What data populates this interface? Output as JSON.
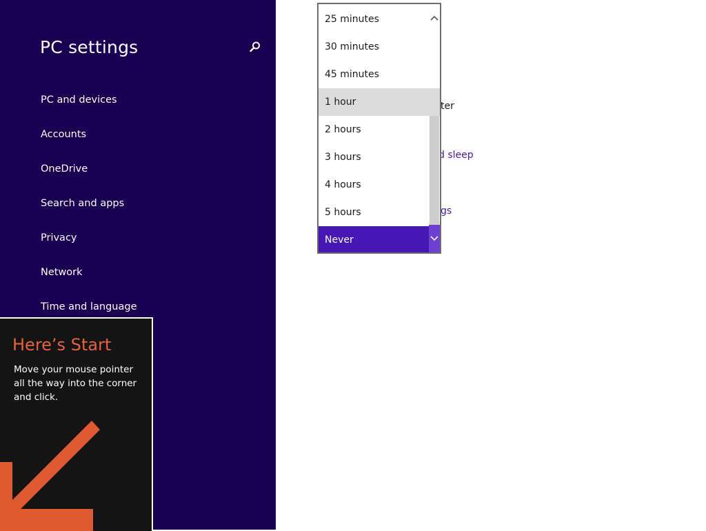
{
  "sidebar": {
    "title": "PC settings",
    "search_icon": "search-icon",
    "items": [
      {
        "label": "PC and devices"
      },
      {
        "label": "Accounts"
      },
      {
        "label": "OneDrive"
      },
      {
        "label": "Search and apps"
      },
      {
        "label": "Privacy"
      },
      {
        "label": "Network"
      },
      {
        "label": "Time and language"
      }
    ]
  },
  "content": {
    "fragment_1": "ter",
    "fragment_2": "d sleep",
    "fragment_3": "gs"
  },
  "dropdown": {
    "options": [
      {
        "label": "25 minutes"
      },
      {
        "label": "30 minutes"
      },
      {
        "label": "45 minutes"
      },
      {
        "label": "1 hour"
      },
      {
        "label": "2 hours"
      },
      {
        "label": "3 hours"
      },
      {
        "label": "4 hours"
      },
      {
        "label": "5 hours"
      },
      {
        "label": "Never"
      }
    ],
    "hovered": "1 hour",
    "selected": "Never",
    "up_icon": "chevron-up-icon",
    "down_icon": "chevron-down-icon"
  },
  "start_tip": {
    "title": "Here’s Start",
    "body": "Move your mouse pointer all the way into the corner and click.",
    "arrow_icon": "arrow-down-left-icon"
  },
  "colors": {
    "sidebar_bg": "#180052",
    "accent": "#4617b4",
    "tip_title": "#e8623a",
    "arrow": "#e05a30"
  }
}
